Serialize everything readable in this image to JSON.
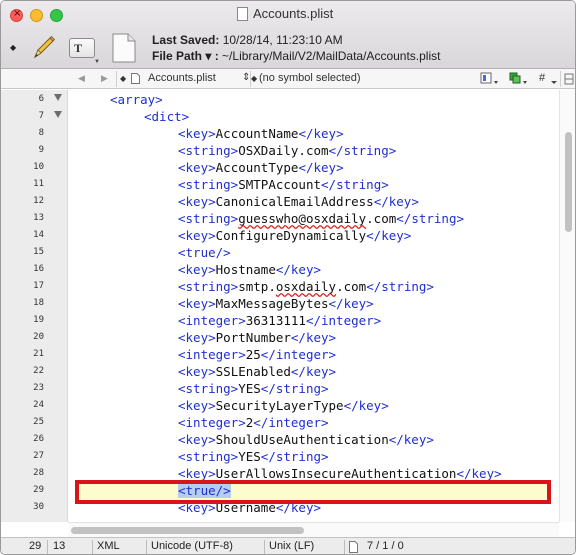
{
  "window": {
    "title": "Accounts.plist"
  },
  "toolbar": {
    "last_saved_label": "Last Saved:",
    "last_saved_value": "10/28/14, 11:23:10 AM",
    "file_path_label": "File Path ▾ :",
    "file_path_value": "~/Library/Mail/V2/MailData/Accounts.plist",
    "pencil_icon": "pencil-icon",
    "text_tool_glyph": "T",
    "bullet": "◆"
  },
  "navbar": {
    "back": "◀",
    "forward": "▶",
    "file_bullet": "◆",
    "file_name": "Accounts.plist",
    "file_arrows": "⇕",
    "symbol_bullet": "◆",
    "symbol": "(no symbol selected)",
    "hash": "#"
  },
  "code_lines": [
    {
      "num": "6",
      "fold": true,
      "indent": 1,
      "parts": [
        [
          "tag",
          "<array>"
        ]
      ]
    },
    {
      "num": "7",
      "fold": true,
      "indent": 2,
      "parts": [
        [
          "tag",
          "<dict>"
        ]
      ]
    },
    {
      "num": "8",
      "indent": 3,
      "parts": [
        [
          "tag",
          "<key>"
        ],
        [
          "txt",
          "AccountName"
        ],
        [
          "tag",
          "</key>"
        ]
      ]
    },
    {
      "num": "9",
      "indent": 3,
      "parts": [
        [
          "tag",
          "<string>"
        ],
        [
          "txt",
          "OSXDaily.com"
        ],
        [
          "tag",
          "</string>"
        ]
      ]
    },
    {
      "num": "10",
      "indent": 3,
      "parts": [
        [
          "tag",
          "<key>"
        ],
        [
          "txt",
          "AccountType"
        ],
        [
          "tag",
          "</key>"
        ]
      ]
    },
    {
      "num": "11",
      "indent": 3,
      "parts": [
        [
          "tag",
          "<string>"
        ],
        [
          "txt",
          "SMTPAccount"
        ],
        [
          "tag",
          "</string>"
        ]
      ]
    },
    {
      "num": "12",
      "indent": 3,
      "parts": [
        [
          "tag",
          "<key>"
        ],
        [
          "txt",
          "CanonicalEmailAddress"
        ],
        [
          "tag",
          "</key>"
        ]
      ]
    },
    {
      "num": "13",
      "indent": 3,
      "parts": [
        [
          "tag",
          "<string>"
        ],
        [
          "squig",
          "guesswho@osxdaily"
        ],
        [
          "txt",
          ".com"
        ],
        [
          "tag",
          "</string>"
        ]
      ]
    },
    {
      "num": "14",
      "indent": 3,
      "parts": [
        [
          "tag",
          "<key>"
        ],
        [
          "txt",
          "ConfigureDynamically"
        ],
        [
          "tag",
          "</key>"
        ]
      ]
    },
    {
      "num": "15",
      "indent": 3,
      "parts": [
        [
          "tag",
          "<true/>"
        ]
      ]
    },
    {
      "num": "16",
      "indent": 3,
      "parts": [
        [
          "tag",
          "<key>"
        ],
        [
          "txt",
          "Hostname"
        ],
        [
          "tag",
          "</key>"
        ]
      ]
    },
    {
      "num": "17",
      "indent": 3,
      "parts": [
        [
          "tag",
          "<string>"
        ],
        [
          "txt",
          "smtp."
        ],
        [
          "squig",
          "osxdaily"
        ],
        [
          "txt",
          ".com"
        ],
        [
          "tag",
          "</string>"
        ]
      ]
    },
    {
      "num": "18",
      "indent": 3,
      "parts": [
        [
          "tag",
          "<key>"
        ],
        [
          "txt",
          "MaxMessageBytes"
        ],
        [
          "tag",
          "</key>"
        ]
      ]
    },
    {
      "num": "19",
      "indent": 3,
      "parts": [
        [
          "tag",
          "<integer>"
        ],
        [
          "txt",
          "36313111"
        ],
        [
          "tag",
          "</integer>"
        ]
      ]
    },
    {
      "num": "20",
      "indent": 3,
      "parts": [
        [
          "tag",
          "<key>"
        ],
        [
          "txt",
          "PortNumber"
        ],
        [
          "tag",
          "</key>"
        ]
      ]
    },
    {
      "num": "21",
      "indent": 3,
      "parts": [
        [
          "tag",
          "<integer>"
        ],
        [
          "txt",
          "25"
        ],
        [
          "tag",
          "</integer>"
        ]
      ]
    },
    {
      "num": "22",
      "indent": 3,
      "parts": [
        [
          "tag",
          "<key>"
        ],
        [
          "txt",
          "SSLEnabled"
        ],
        [
          "tag",
          "</key>"
        ]
      ]
    },
    {
      "num": "23",
      "indent": 3,
      "parts": [
        [
          "tag",
          "<string>"
        ],
        [
          "txt",
          "YES"
        ],
        [
          "tag",
          "</string>"
        ]
      ]
    },
    {
      "num": "24",
      "indent": 3,
      "parts": [
        [
          "tag",
          "<key>"
        ],
        [
          "txt",
          "SecurityLayerType"
        ],
        [
          "tag",
          "</key>"
        ]
      ]
    },
    {
      "num": "25",
      "indent": 3,
      "parts": [
        [
          "tag",
          "<integer>"
        ],
        [
          "txt",
          "2"
        ],
        [
          "tag",
          "</integer>"
        ]
      ]
    },
    {
      "num": "26",
      "indent": 3,
      "parts": [
        [
          "tag",
          "<key>"
        ],
        [
          "txt",
          "ShouldUseAuthentication"
        ],
        [
          "tag",
          "</key>"
        ]
      ]
    },
    {
      "num": "27",
      "indent": 3,
      "parts": [
        [
          "tag",
          "<string>"
        ],
        [
          "txt",
          "YES"
        ],
        [
          "tag",
          "</string>"
        ]
      ]
    },
    {
      "num": "28",
      "indent": 3,
      "parts": [
        [
          "tag",
          "<key>"
        ],
        [
          "txt",
          "UserAllowsInsecureAuthentication"
        ],
        [
          "tag",
          "</key>"
        ]
      ]
    },
    {
      "num": "29",
      "indent": 3,
      "current": true,
      "parts": [
        [
          "sel",
          "<true/>"
        ]
      ]
    },
    {
      "num": "30",
      "indent": 3,
      "parts": [
        [
          "tag",
          "<key>"
        ],
        [
          "txt",
          "Username"
        ],
        [
          "tag",
          "</key>"
        ]
      ]
    }
  ],
  "status_bar": {
    "line": "29",
    "column": "13",
    "language": "XML",
    "encoding": "Unicode (UTF-8)",
    "line_endings": "Unix (LF)",
    "selection": "7 / 1 / 0"
  },
  "colors": {
    "tag": "#1f2fd0",
    "text": "#111111",
    "current_line": "#fdfccc",
    "selection": "#b5cdef",
    "callout": "#d8141b"
  }
}
